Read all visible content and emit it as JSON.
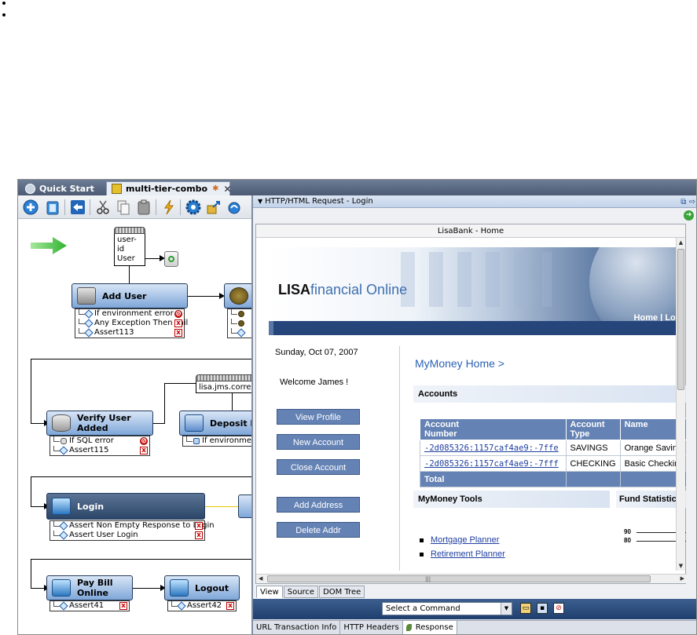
{
  "window": {
    "tabs": [
      {
        "label": "Quick Start"
      },
      {
        "label": "multi-tier-combo",
        "modified_marker": "✱",
        "close": "✕"
      }
    ]
  },
  "toolbar": {
    "icons": [
      "add-step-icon",
      "delete-icon",
      "back-icon",
      "cut-icon",
      "copy-icon",
      "paste-icon",
      "run-icon",
      "settings-icon",
      "export-icon",
      "wizard-icon"
    ]
  },
  "canvas": {
    "datasets": [
      {
        "line1": "user-id",
        "line2": "User"
      },
      {
        "line1": "lisa.jms.correla"
      }
    ],
    "steps": {
      "add_user": {
        "label": "Add User",
        "asserts": [
          "If environment error",
          "Any Exception Then Fail",
          "Assert113"
        ]
      },
      "verify_user": {
        "label": "Verify User Added",
        "asserts": [
          "If SQL error",
          "Assert115"
        ]
      },
      "deposit": {
        "label": "Deposit Mo",
        "asserts": [
          "If environmen"
        ]
      },
      "login": {
        "label": "Login",
        "asserts": [
          "Assert Non Empty Response to Login",
          "Assert User Login"
        ]
      },
      "pay_bill": {
        "label": "Pay Bill Online",
        "asserts": [
          "Assert41"
        ]
      },
      "logout": {
        "label": "Logout",
        "asserts": [
          "Assert42"
        ]
      }
    }
  },
  "panel": {
    "title": "HTTP/HTML Request - Login",
    "browser": {
      "page_title": "LisaBank - Home",
      "logo_bold": "LISA",
      "logo_rest": "financial Online",
      "nav_home": "Home",
      "nav_sep": " | ",
      "nav_locations": "Loca",
      "date": "Sunday, Oct 07, 2007",
      "welcome": "Welcome James !",
      "left_buttons": [
        "View Profile",
        "New Account",
        "Close Account",
        "Add Address",
        "Delete Addr"
      ],
      "heading": "MyMoney Home >",
      "accounts_header": "Accounts",
      "table": {
        "columns": [
          {
            "line1": "Account",
            "line2": "Number"
          },
          {
            "line1": "Account",
            "line2": "Type"
          },
          {
            "line1": "Name",
            "line2": ""
          }
        ],
        "rows": [
          [
            "-2d085326:1157caf4ae9:-7ffe",
            "SAVINGS",
            "Orange Savin"
          ],
          [
            "-2d085326:1157caf4ae9:-7fff",
            "CHECKING",
            "Basic Checkin"
          ]
        ],
        "total_label": "Total"
      },
      "tools_header": "MyMoney Tools",
      "fund_header": "Fund Statistic",
      "tools": [
        "Mortgage Planner",
        "Retirement Planner"
      ],
      "fund_chart": {
        "y_labels": [
          "90",
          "80"
        ]
      }
    },
    "sub_tabs": [
      "View",
      "Source",
      "DOM Tree"
    ],
    "active_sub_tab": "View",
    "command_select": "Select a Command",
    "bottom_tabs": [
      "URL Transaction Info",
      "HTTP Headers",
      "Response"
    ],
    "active_bottom_tab": "Response"
  }
}
